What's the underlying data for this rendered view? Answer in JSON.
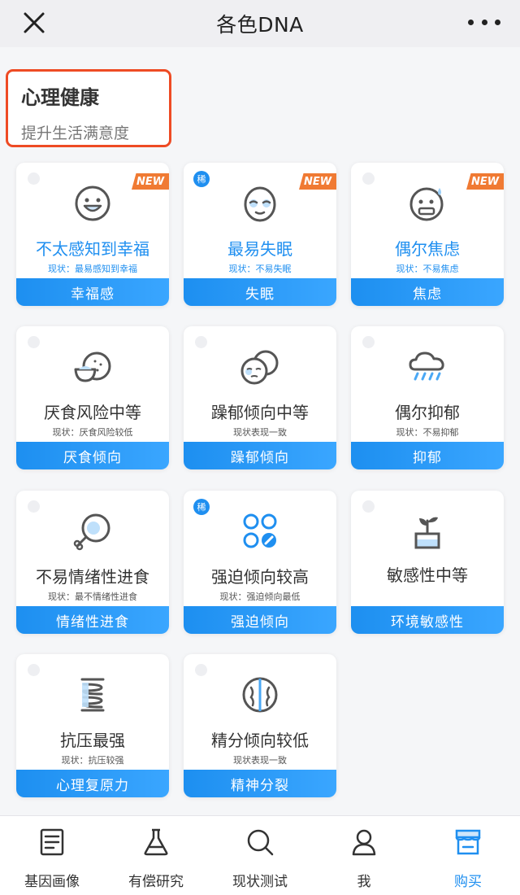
{
  "app": {
    "title": "各色DNA"
  },
  "header": {
    "title": "心理健康",
    "subtitle": "提升生活满意度"
  },
  "cards": [
    {
      "name": "不太感知到幸福",
      "status": "现状：最易感知到幸福",
      "category": "幸福感",
      "new_badge": "NEW",
      "highlight": true,
      "icon": "smile-face-icon"
    },
    {
      "name": "最易失眠",
      "status": "现状：不易失眠",
      "category": "失眠",
      "new_badge": "NEW",
      "rare_badge": "稀",
      "highlight": true,
      "icon": "sleepy-face-icon"
    },
    {
      "name": "偶尔焦虑",
      "status": "现状：不易焦虑",
      "category": "焦虑",
      "new_badge": "NEW",
      "highlight": true,
      "icon": "anxious-face-icon"
    },
    {
      "name": "厌食风险中等",
      "status": "现状：厌食风险较低",
      "category": "厌食倾向",
      "icon": "food-bowl-icon"
    },
    {
      "name": "躁郁倾向中等",
      "status": "现状表现一致",
      "category": "躁郁倾向",
      "icon": "mood-faces-icon"
    },
    {
      "name": "偶尔抑郁",
      "status": "现状：不易抑郁",
      "category": "抑郁",
      "icon": "rain-cloud-icon"
    },
    {
      "name": "不易情绪性进食",
      "status": "现状：最不情绪性进食",
      "category": "情绪性进食",
      "icon": "drumstick-icon"
    },
    {
      "name": "强迫倾向较高",
      "status": "现状：强迫倾向最低",
      "category": "强迫倾向",
      "rare_badge": "稀",
      "icon": "four-circles-icon"
    },
    {
      "name": "敏感性中等",
      "status": "",
      "category": "环境敏感性",
      "icon": "sprout-pot-icon"
    },
    {
      "name": "抗压最强",
      "status": "现状：抗压较强",
      "category": "心理复原力",
      "icon": "spring-coil-icon"
    },
    {
      "name": "精分倾向较低",
      "status": "现状表现一致",
      "category": "精神分裂",
      "icon": "brain-icon"
    }
  ],
  "nav": [
    {
      "label": "基因画像",
      "icon": "document-list-icon"
    },
    {
      "label": "有偿研究",
      "icon": "flask-icon"
    },
    {
      "label": "现状测试",
      "icon": "magnifier-icon"
    },
    {
      "label": "我",
      "icon": "person-icon"
    },
    {
      "label": "购买",
      "icon": "shop-icon",
      "active": true
    }
  ],
  "colors": {
    "accent": "#1f8ff0",
    "new_badge": "#f07a33",
    "header_border": "#ee4b24"
  }
}
